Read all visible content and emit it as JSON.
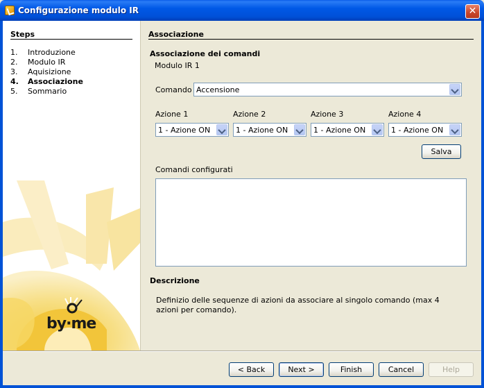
{
  "window": {
    "title": "Configurazione modulo IR",
    "close_glyph": "✕"
  },
  "steps": {
    "title": "Steps",
    "items": [
      {
        "num": "1.",
        "label": "Introduzione",
        "current": false
      },
      {
        "num": "2.",
        "label": "Modulo IR",
        "current": false
      },
      {
        "num": "3.",
        "label": "Aquisizione",
        "current": false
      },
      {
        "num": "4.",
        "label": "Associazione",
        "current": true
      },
      {
        "num": "5.",
        "label": "Sommario",
        "current": false
      }
    ]
  },
  "logo": {
    "text": "by·me"
  },
  "panel": {
    "heading": "Associazione",
    "section_title": "Associazione dei comandi",
    "module_label": "Modulo IR 1",
    "command_label": "Comando",
    "command_value": "Accensione",
    "actions": [
      {
        "label": "Azione 1",
        "value": "1 - Azione ON"
      },
      {
        "label": "Azione 2",
        "value": "1 - Azione ON"
      },
      {
        "label": "Azione 3",
        "value": "1 - Azione ON"
      },
      {
        "label": "Azione 4",
        "value": "1 - Azione ON"
      }
    ],
    "save_label": "Salva",
    "configured_label": "Comandi configurati",
    "description_title": "Descrizione",
    "description_text": "Definizio delle sequenze di azioni da associare al singolo comando (max 4 azioni per comando)."
  },
  "buttons": {
    "back": "< Back",
    "next": "Next >",
    "finish": "Finish",
    "cancel": "Cancel",
    "help": "Help"
  },
  "colors": {
    "titlebar": "#0058e6",
    "panel_bg": "#ece9d8",
    "sun": "#f5d35a"
  }
}
